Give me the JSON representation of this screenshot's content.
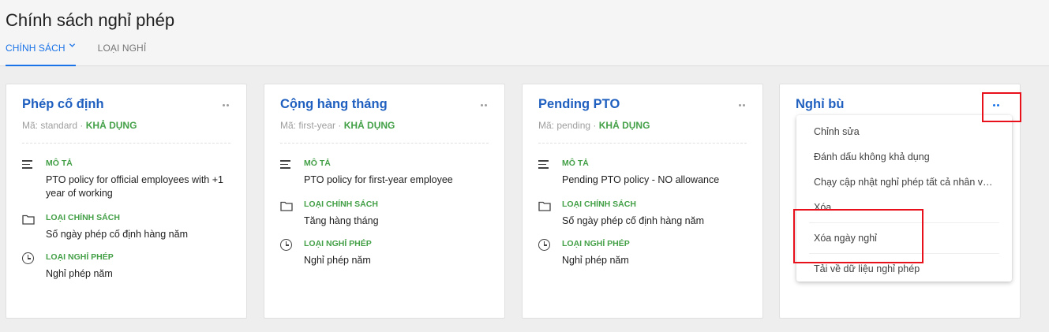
{
  "page": {
    "title": "Chính sách nghỉ phép"
  },
  "tabs": [
    {
      "label": "CHÍNH SÁCH",
      "active": true
    },
    {
      "label": "LOẠI NGHỈ",
      "active": false
    }
  ],
  "labels": {
    "code_prefix": "Mã:",
    "description": "MÔ TẢ",
    "policy_type": "LOẠI CHÍNH SÁCH",
    "leave_type": "LOẠI NGHỈ PHÉP"
  },
  "cards": [
    {
      "title": "Phép cố định",
      "code": "standard",
      "status": "KHẢ DỤNG",
      "description": "PTO policy for official employees with +1 year of working",
      "policy_type": "Số ngày phép cố định hàng năm",
      "leave_type": "Nghỉ phép năm"
    },
    {
      "title": "Cộng hàng tháng",
      "code": "first-year",
      "status": "KHẢ DỤNG",
      "description": "PTO policy for first-year employee",
      "policy_type": "Tăng hàng tháng",
      "leave_type": "Nghỉ phép năm"
    },
    {
      "title": "Pending PTO",
      "code": "pending",
      "status": "KHẢ DỤNG",
      "description": "Pending PTO policy - NO allowance",
      "policy_type": "Số ngày phép cố định hàng năm",
      "leave_type": "Nghỉ phép năm"
    },
    {
      "title": "Nghỉ bù"
    }
  ],
  "menu": {
    "items": [
      "Chỉnh sửa",
      "Đánh dấu không khả dụng",
      "Chạy cập nhật nghỉ phép tất cả nhân viên",
      "Xóa",
      "Xóa ngày nghỉ",
      "Tải về dữ liệu nghỉ phép"
    ]
  },
  "colors": {
    "accent": "#1a73e8",
    "title_blue": "#1f5fbf",
    "status_green": "#43a047",
    "highlight_red": "#e8111b"
  },
  "icons": [
    "chevron-down-icon",
    "more-dots-icon",
    "description-lines-icon",
    "folder-icon",
    "clock-icon"
  ]
}
